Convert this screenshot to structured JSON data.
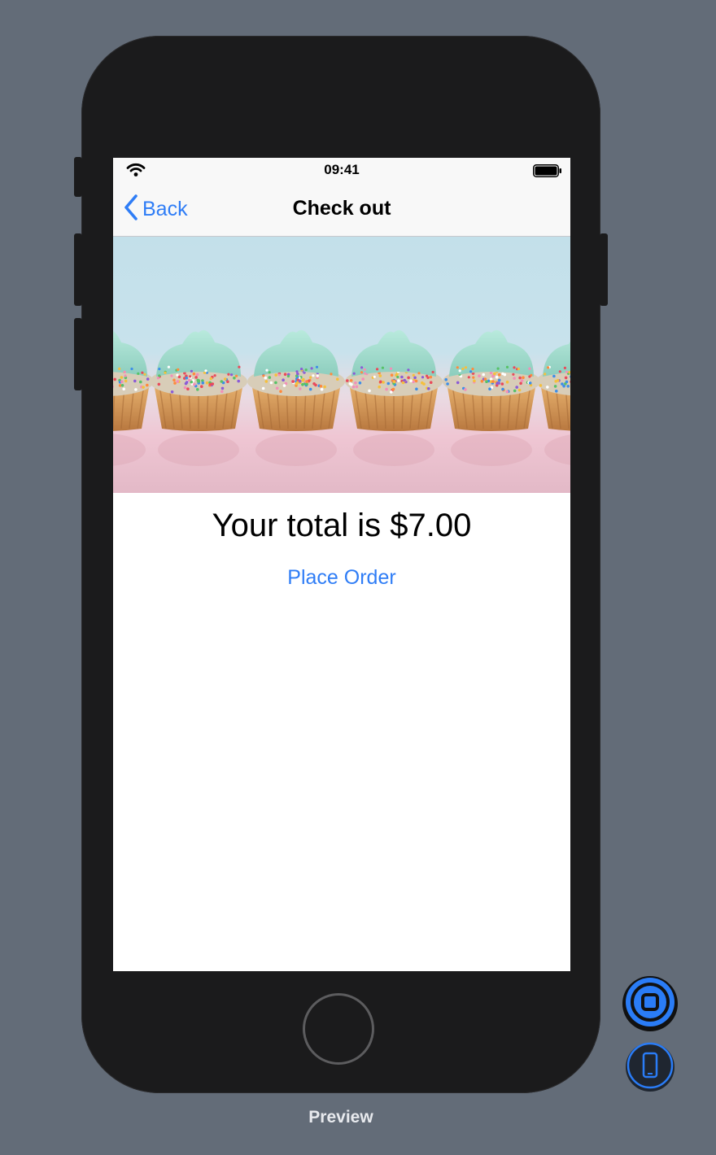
{
  "status_bar": {
    "time": "09:41"
  },
  "nav": {
    "back_label": "Back",
    "title": "Check out"
  },
  "hero": {
    "alt": "Cupcakes with mint frosting and sprinkles"
  },
  "content": {
    "total_text": "Your total is $7.00",
    "place_order_label": "Place Order"
  },
  "canvas": {
    "preview_label": "Preview"
  },
  "colors": {
    "accent": "#2f7df6",
    "canvas_bg": "#636c78",
    "device_body": "#1b1b1c"
  },
  "icons": {
    "wifi": "wifi-icon",
    "battery": "battery-icon",
    "back": "chevron-left-icon",
    "live_preview": "live-preview-icon",
    "device": "device-icon"
  }
}
